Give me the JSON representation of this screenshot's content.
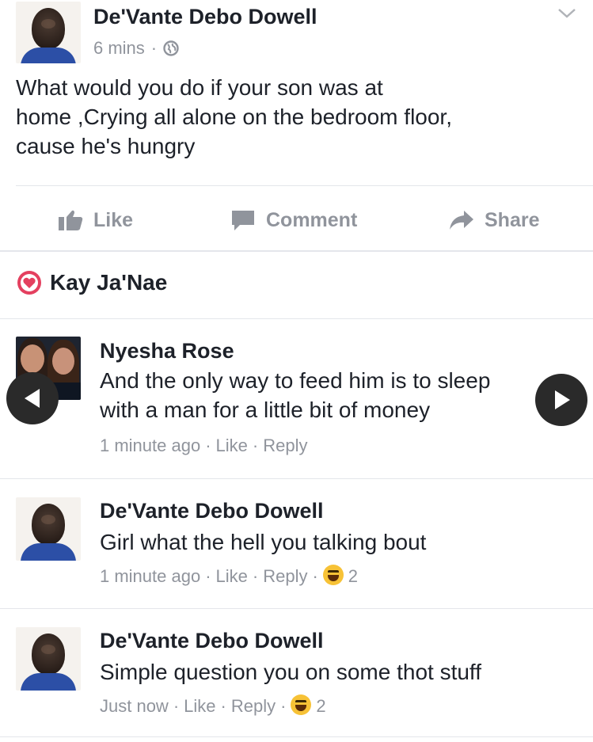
{
  "post": {
    "author": "De'Vante Debo Dowell",
    "time": "6 mins",
    "dot": "·",
    "text_lines": [
      "What would you do if your son was at",
      "home ,Crying all alone on the bedroom floor,",
      "cause he's hungry"
    ]
  },
  "actions": {
    "like": "Like",
    "comment": "Comment",
    "share": "Share"
  },
  "reactions_row": {
    "name": "Kay Ja'Nae",
    "icon": "love-reaction-icon"
  },
  "comments": [
    {
      "author": "Nyesha Rose",
      "lines": [
        "And the only way to feed him is to sleep",
        "with a man for a little bit of money"
      ],
      "time": "1 minute ago",
      "like": "Like",
      "reply": "Reply",
      "reaction_count": ""
    },
    {
      "author": "De'Vante Debo Dowell",
      "lines": [
        "Girl what the hell you talking bout"
      ],
      "time": "1 minute ago",
      "like": "Like",
      "reply": "Reply",
      "reaction_count": "2"
    },
    {
      "author": "De'Vante Debo Dowell",
      "lines": [
        "Simple question you on some thot stuff"
      ],
      "time": "Just now",
      "like": "Like",
      "reply": "Reply",
      "reaction_count": "2"
    }
  ],
  "colors": {
    "text": "#1d2129",
    "meta": "#90949c",
    "love": "#e4405f",
    "divider": "#e4e6eb"
  }
}
